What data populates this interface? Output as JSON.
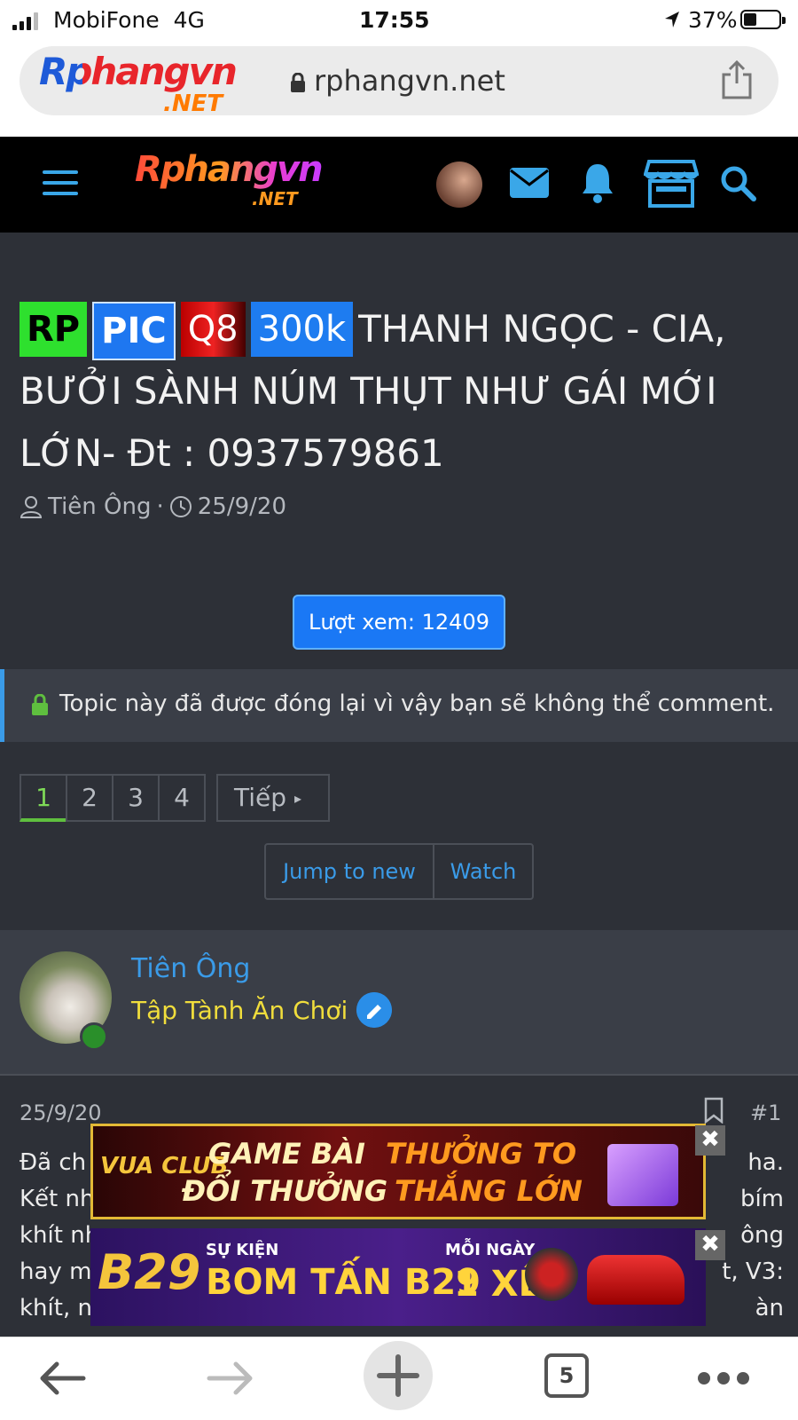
{
  "status": {
    "carrier": "MobiFone",
    "network": "4G",
    "time": "17:55",
    "battery_pct": "37%",
    "battery_level": 0.37,
    "signal_bars": 3
  },
  "browser": {
    "logo_text": "Rphangvn",
    "logo_sub": ".NET",
    "url": "rphangvn.net",
    "tabs_count": "5"
  },
  "site": {
    "logo_text": "Rphangvn",
    "logo_sub": ".NET"
  },
  "thread": {
    "badges": {
      "rp": "RP",
      "pic": "PIC",
      "area": "Q8",
      "price": "300k"
    },
    "title": "THANH NGỌC - CIA, BƯỞI SÀNH NÚM THỤT NHƯ GÁI MỚI LỚN- Đt : 0937579861",
    "author": "Tiên Ông",
    "date": "25/9/20",
    "views_label": "Lượt xem: 12409",
    "locked_notice": "Topic này đã được đóng lại vì vậy bạn sẽ không thể comment."
  },
  "pagination": {
    "pages": [
      "1",
      "2",
      "3",
      "4"
    ],
    "current": "1",
    "next_label": "Tiếp"
  },
  "actions": {
    "jump": "Jump to new",
    "watch": "Watch"
  },
  "post": {
    "username": "Tiên Ông",
    "user_title": "Tập Tành Ăn Chơi",
    "date": "25/9/20",
    "number": "#1",
    "line1_start": "Đã ch",
    "line1_end": "ha.",
    "line2_start": "Kết nh",
    "line2_end": "bím",
    "line3_start": "khít nh",
    "line3_end": "ông",
    "line4_start": "hay m",
    "line4_end": "t, V3:",
    "line5_start": "khít, n",
    "line5_end": "àn"
  },
  "ads": {
    "ad1_brand": "VUA CLUB",
    "ad1_line1": "GAME BÀI",
    "ad1_line2": "ĐỔI THƯỞNG",
    "ad1_line3": "THƯỞNG TO",
    "ad1_line4": "THẮNG LỚN",
    "ad2_brand": "B29",
    "ad2_small": "SỰ KIỆN",
    "ad2_big": "BOM TẤN B29",
    "ad2_side_small": "MỖI NGÀY",
    "ad2_side_big": "1 XẾ",
    "close": "✖"
  },
  "colors": {
    "accent": "#3a9be8",
    "page_bg": "#2d3037",
    "active_page": "#7ed957",
    "user_title": "#f0dd3c",
    "views_btn": "#1a78f5"
  },
  "icons": [
    "signal-icon",
    "location-icon",
    "battery-icon",
    "lock-icon",
    "share-icon",
    "hamburger-icon",
    "mail-icon",
    "bell-icon",
    "store-icon",
    "search-icon",
    "user-icon",
    "clock-icon",
    "bookmark-icon",
    "back-icon",
    "forward-icon",
    "plus-icon",
    "more-icon"
  ]
}
